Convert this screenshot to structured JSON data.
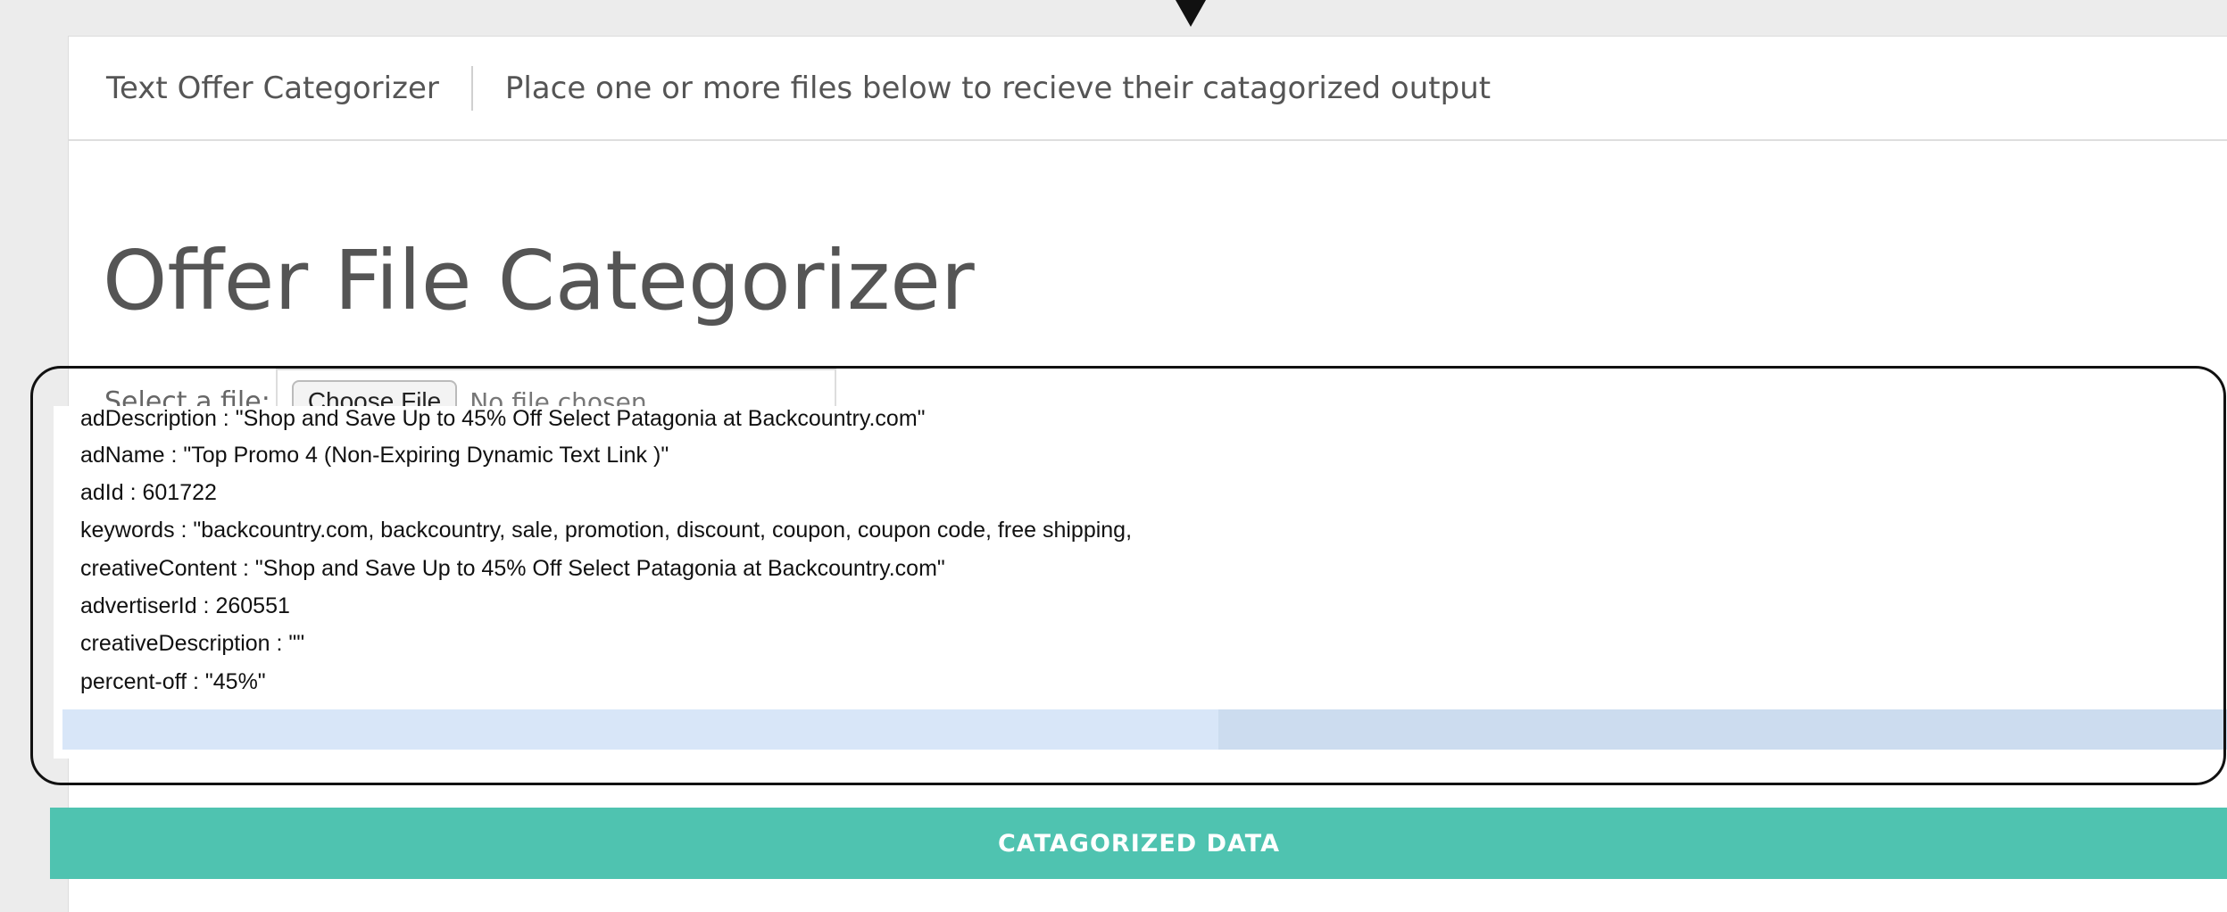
{
  "navbar": {
    "brand": "Text Offer Categorizer",
    "subtitle": "Place one or more files below to recieve their catagorized output"
  },
  "main": {
    "title": "Offer File Categorizer",
    "file_selector": {
      "label": "Select a file:",
      "button_label": "Choose File",
      "status": "No file chosen"
    },
    "output_lines": [
      "adDescription : \"Shop and Save Up to 45% Off Select Patagonia at Backcountry.com\"",
      "adName : \"Top Promo 4 (Non-Expiring Dynamic Text Link )\"",
      "adId : 601722",
      "keywords : \"backcountry.com, backcountry, sale, promotion, discount, coupon, coupon code, free shipping,",
      "creativeContent : \"Shop and Save Up to 45% Off Select Patagonia at Backcountry.com\"",
      "advertiserId : 260551",
      "creativeDescription : \"\"",
      "percent-off : \"45%\""
    ],
    "categorize_button": "CATAGORIZED DATA"
  },
  "colors": {
    "accent": "#4fc3b0",
    "highlight": "#d8e6f8",
    "background": "#ececec"
  }
}
